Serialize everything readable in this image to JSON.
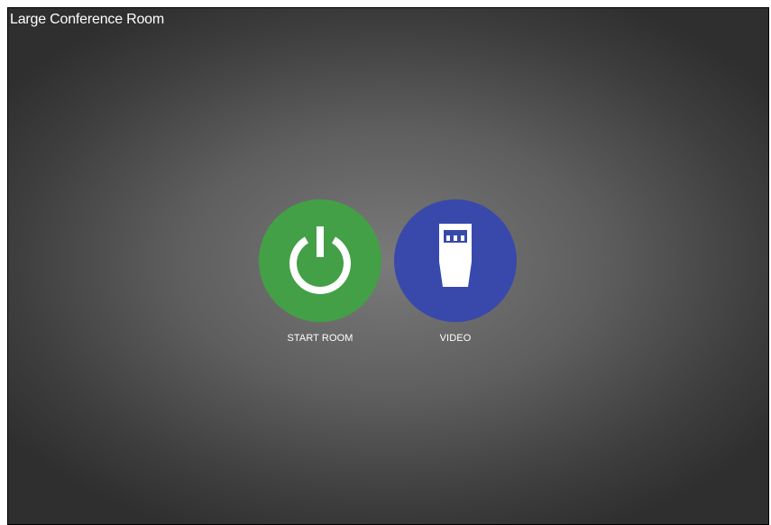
{
  "room": {
    "title": "Large Conference Room"
  },
  "buttons": [
    {
      "label": "START ROOM",
      "icon": "power-icon",
      "color": "#43a047"
    },
    {
      "label": "VIDEO",
      "icon": "hdmi-connector-icon",
      "color": "#3949ab"
    }
  ]
}
